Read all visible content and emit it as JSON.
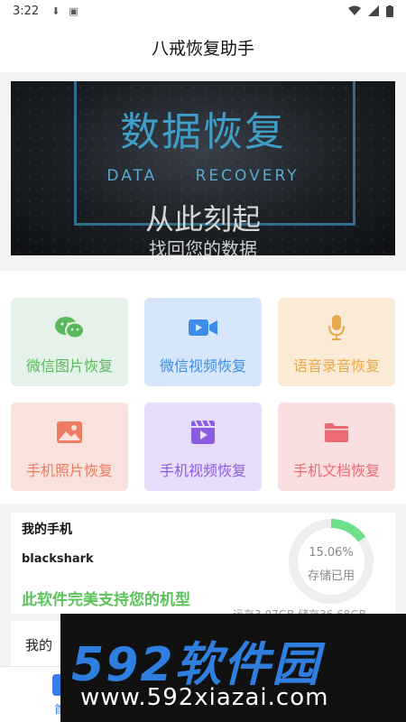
{
  "status_bar": {
    "time": "3:22",
    "icons": [
      "download-icon",
      "a-icon"
    ],
    "right_icons": [
      "wifi-icon",
      "signal-icon",
      "battery-icon"
    ]
  },
  "app_bar": {
    "title": "八戒恢复助手"
  },
  "banner": {
    "title": "数据恢复",
    "subtitle": "DATA RECOVERY",
    "line1": "从此刻起",
    "line2": "找回您的数据"
  },
  "features": [
    {
      "label": "微信图片恢复",
      "icon": "wechat-icon",
      "color": "#5cb85c",
      "bg": "#e4f2ea"
    },
    {
      "label": "微信视频恢复",
      "icon": "video-camera-icon",
      "color": "#3d8ce8",
      "bg": "#d8e6fb"
    },
    {
      "label": "语音录音恢复",
      "icon": "microphone-icon",
      "color": "#e9a84a",
      "bg": "#faebd7"
    },
    {
      "label": "手机照片恢复",
      "icon": "photo-icon",
      "color": "#ee7b63",
      "bg": "#f9e1dc"
    },
    {
      "label": "手机视频恢复",
      "icon": "film-icon",
      "color": "#8a5de0",
      "bg": "#e6ddfa"
    },
    {
      "label": "手机文档恢复",
      "icon": "folder-icon",
      "color": "#ec6b73",
      "bg": "#f9dfe0"
    }
  ],
  "phone_info": {
    "heading": "我的手机",
    "model": "blackshark",
    "support_text": "此软件完美支持您的机型",
    "storage_percent": "15.06%",
    "storage_fraction": 0.1506,
    "storage_label": "存储已用",
    "storage_detail": "运存3.07GB 储存36.68GB",
    "ring_color": "#6ee08a",
    "ring_bg": "#eeeeee"
  },
  "second_card": {
    "title": "我的"
  },
  "bottom_nav": {
    "home_label": "首页"
  },
  "watermark": {
    "brand": "592软件园",
    "url": "www.592xiazai.com"
  }
}
